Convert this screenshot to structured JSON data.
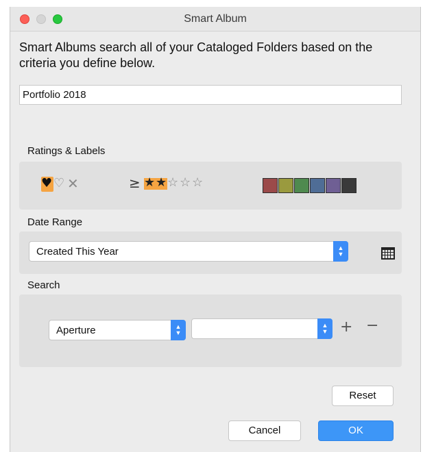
{
  "window": {
    "title": "Smart Album"
  },
  "intro_text": "Smart Albums search all of your Cataloged Folders based on the criteria you define below.",
  "album_name": "Portfolio 2018",
  "ratings_section": {
    "label": "Ratings & Labels",
    "flags": {
      "selected": "picked",
      "icons": [
        "heart-filled-icon",
        "heart-outline-icon",
        "reject-x-icon"
      ]
    },
    "rating_operator": "≥",
    "rating_value": 2,
    "rating_max": 5,
    "accent_color": "#f5a442",
    "color_labels": [
      "#9b4a4a",
      "#9a9a3e",
      "#4f8a4f",
      "#4f6d96",
      "#6f5f94",
      "#3a3a3a"
    ]
  },
  "date_section": {
    "label": "Date Range",
    "selected": "Created This Year"
  },
  "search_section": {
    "label": "Search",
    "field": "Aperture",
    "value": ""
  },
  "buttons": {
    "reset": "Reset",
    "cancel": "Cancel",
    "ok": "OK"
  },
  "colors": {
    "primary": "#3d96f7",
    "close": "#fc5f57",
    "zoom": "#28c840"
  }
}
